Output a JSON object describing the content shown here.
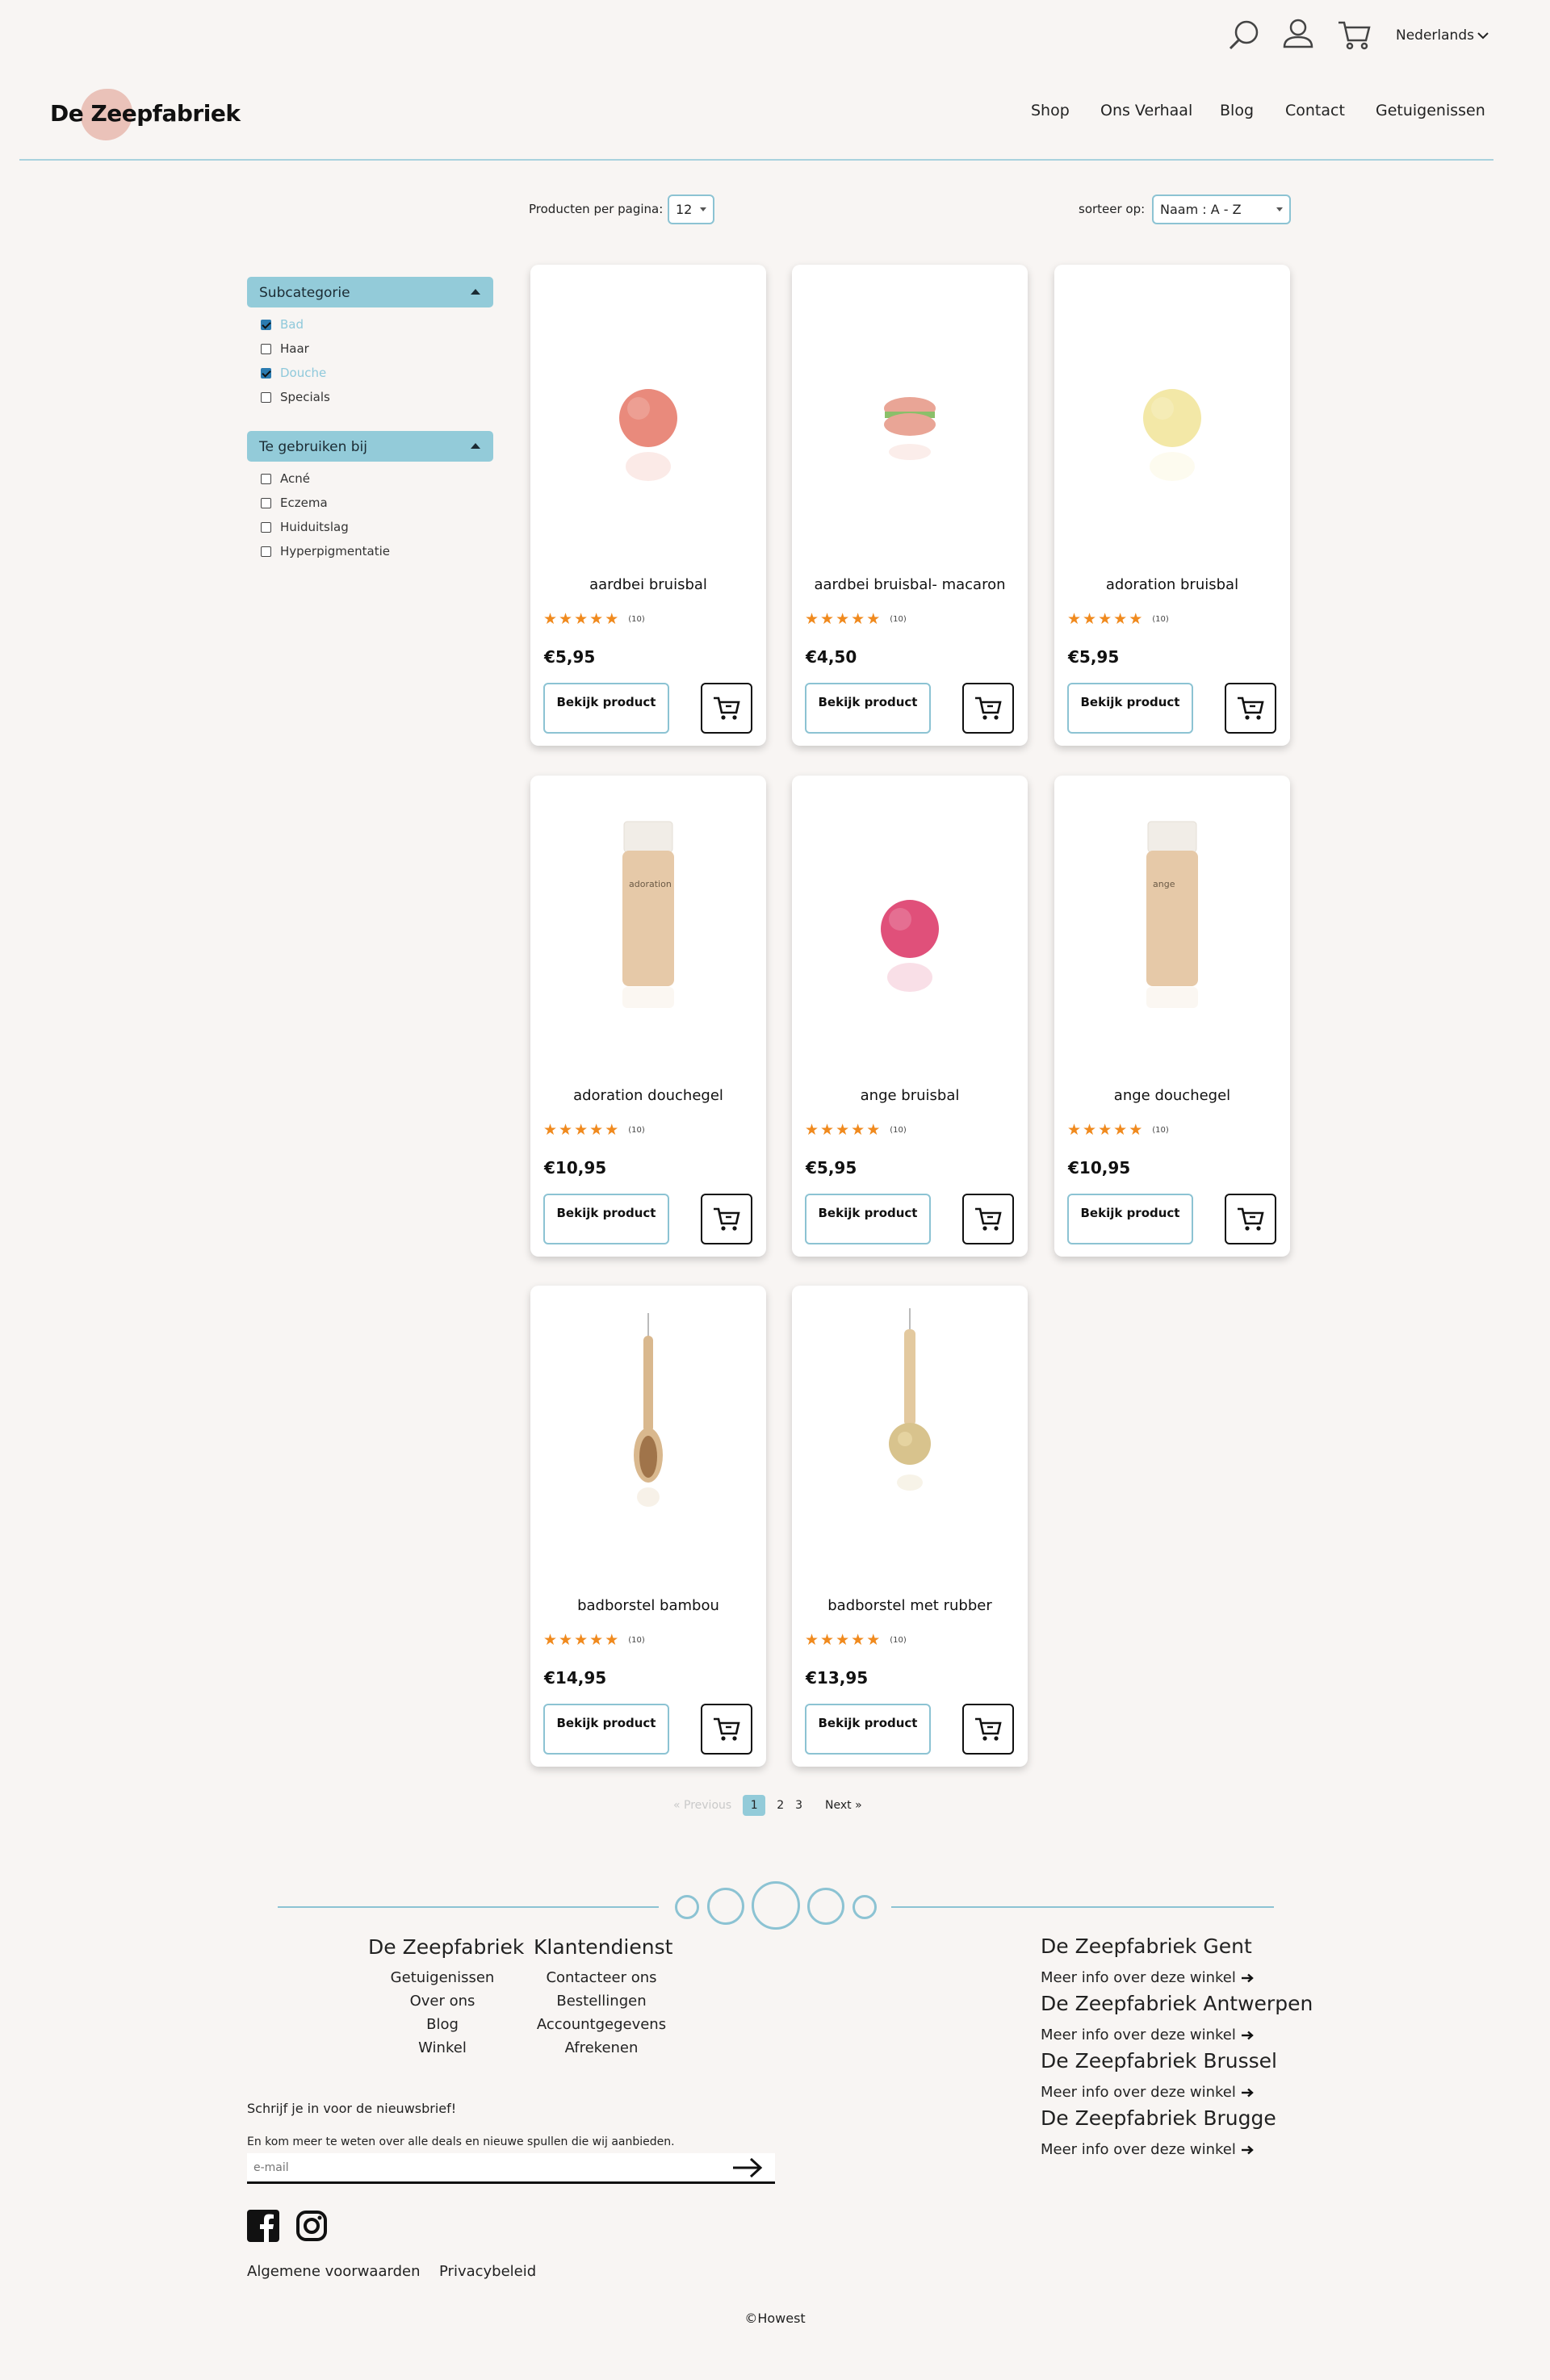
{
  "header": {
    "language": "Nederlands",
    "logo_text": "De Zeepfabriek",
    "nav": [
      "Shop",
      "Ons Verhaal",
      "Blog",
      "Contact",
      "Getuigenissen"
    ]
  },
  "controls": {
    "per_page_label": "Producten per pagina:",
    "per_page_value": "12",
    "sort_label": "sorteer op:",
    "sort_value": "Naam : A - Z"
  },
  "filters": [
    {
      "title": "Subcategorie",
      "options": [
        {
          "label": "Bad",
          "checked": true
        },
        {
          "label": "Haar",
          "checked": false
        },
        {
          "label": "Douche",
          "checked": true
        },
        {
          "label": "Specials",
          "checked": false
        }
      ]
    },
    {
      "title": "Te gebruiken bij",
      "options": [
        {
          "label": "Acné",
          "checked": false
        },
        {
          "label": "Eczema",
          "checked": false
        },
        {
          "label": "Huiduitslag",
          "checked": false
        },
        {
          "label": "Hyperpigmentatie",
          "checked": false
        }
      ]
    }
  ],
  "products": [
    {
      "name": "aardbei bruisbal",
      "price": "€5,95",
      "reviews": "(10)",
      "rating": 5,
      "image": "pink-ball",
      "color": "#e98a7c"
    },
    {
      "name": "aardbei bruisbal- macaron",
      "price": "€4,50",
      "reviews": "(10)",
      "rating": 5,
      "image": "macaron",
      "color": "#e9a596"
    },
    {
      "name": "adoration bruisbal",
      "price": "€5,95",
      "reviews": "(10)",
      "rating": 5,
      "image": "yellow-ball",
      "color": "#f3e8a7"
    },
    {
      "name": "adoration douchegel",
      "price": "€10,95",
      "reviews": "(10)",
      "rating": 5,
      "image": "bottle",
      "color": "#e6c9a8",
      "bottle_text": "adoration"
    },
    {
      "name": "ange bruisbal",
      "price": "€5,95",
      "reviews": "(10)",
      "rating": 5,
      "image": "magenta-ball",
      "color": "#e0507a"
    },
    {
      "name": "ange douchegel",
      "price": "€10,95",
      "reviews": "(10)",
      "rating": 5,
      "image": "bottle",
      "color": "#e6c9a8",
      "bottle_text": "ange"
    },
    {
      "name": "badborstel bambou",
      "price": "€14,95",
      "reviews": "(10)",
      "rating": 5,
      "image": "brush",
      "color": "#d9b88e"
    },
    {
      "name": "badborstel met rubber",
      "price": "€13,95",
      "reviews": "(10)",
      "rating": 5,
      "image": "sponge-brush",
      "color": "#e3c99f"
    }
  ],
  "card_button_label": "Bekijk product",
  "pagination": {
    "previous": "« Previous",
    "pages": [
      "1",
      "2",
      "3"
    ],
    "current": "1",
    "next": "Next »"
  },
  "footer": {
    "col1": {
      "title": "De Zeepfabriek",
      "links": [
        "Getuigenissen",
        "Over ons",
        "Blog",
        "Winkel"
      ]
    },
    "col2": {
      "title": "Klantendienst",
      "links": [
        "Contacteer ons",
        "Bestellingen",
        "Accountgegevens",
        "Afrekenen"
      ]
    },
    "stores": [
      {
        "name": "De Zeepfabriek Gent",
        "more": "Meer info over deze winkel"
      },
      {
        "name": "De Zeepfabriek Antwerpen",
        "more": "Meer info over deze winkel"
      },
      {
        "name": "De Zeepfabriek Brussel",
        "more": "Meer info over deze winkel"
      },
      {
        "name": "De Zeepfabriek Brugge",
        "more": "Meer info over deze winkel"
      }
    ],
    "newsletter_title": "Schrijf je in voor de nieuwsbrief!",
    "newsletter_text": "En kom meer te weten over alle deals en nieuwe spullen die wij aanbieden.",
    "email_placeholder": "e-mail",
    "legal": [
      "Algemene voorwaarden",
      "Privacybeleid"
    ],
    "copyright": "©Howest"
  },
  "colors": {
    "accent": "#93cbd9",
    "star": "#f08a1e",
    "background": "#f8f5f3"
  }
}
